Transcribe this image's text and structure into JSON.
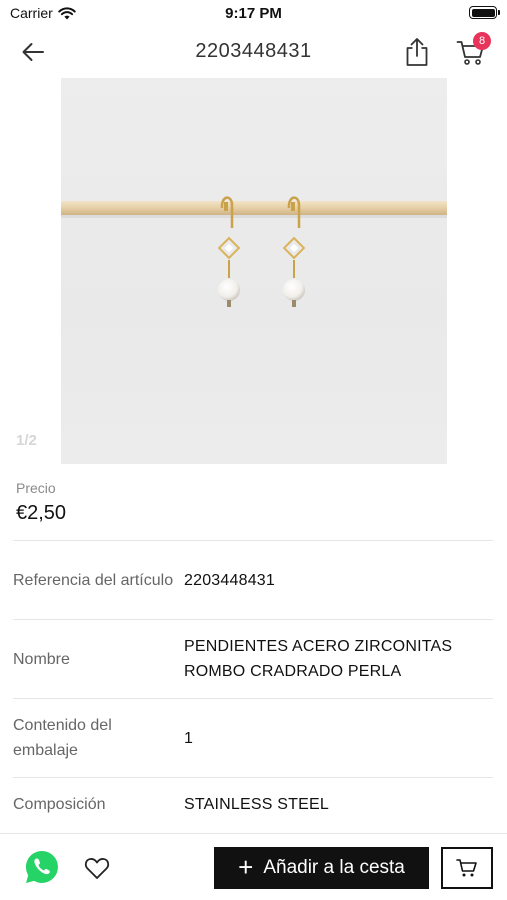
{
  "status_bar": {
    "carrier": "Carrier",
    "time": "9:17 PM"
  },
  "nav": {
    "title": "2203448431",
    "cart_count": "8"
  },
  "gallery": {
    "counter": "1/2"
  },
  "price": {
    "label": "Precio",
    "value": "€2,50"
  },
  "details": [
    {
      "label": "Referencia del artículo",
      "value": "2203448431"
    },
    {
      "label": "Nombre",
      "value": "PENDIENTES ACERO ZIRCONITAS ROMBO CRADRADO PERLA"
    },
    {
      "label": "Contenido del embalaje",
      "value": "1"
    },
    {
      "label": "Composición",
      "value": "STAINLESS STEEL"
    }
  ],
  "bottom_bar": {
    "add_to_cart_label": "Añadir a la cesta"
  },
  "colors": {
    "badge": "#e8335a",
    "whatsapp": "#25d366",
    "primary_button": "#111111"
  },
  "icons": [
    "wifi-icon",
    "battery-icon",
    "back-arrow-icon",
    "share-icon",
    "cart-icon",
    "whatsapp-icon",
    "heart-icon",
    "plus-icon",
    "cart-outline-icon"
  ]
}
